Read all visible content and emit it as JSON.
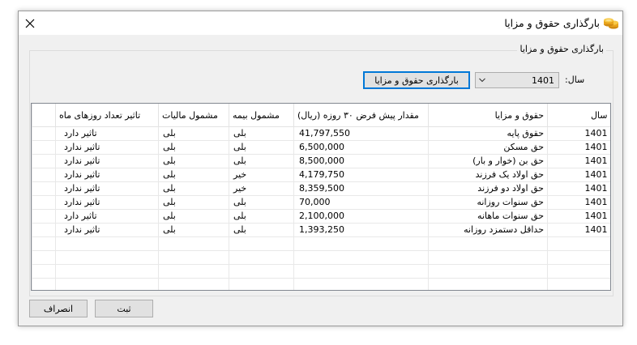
{
  "window": {
    "title": "بارگذاری حقوق و مزایا",
    "icon": "coins-icon"
  },
  "group": {
    "legend": "بارگذاری حقوق و مزایا"
  },
  "filter": {
    "year_label": "سال:",
    "year_value": "1401",
    "load_button": "بارگذاری حقوق و مزایا"
  },
  "table": {
    "columns": [
      "سال",
      "حقوق و مزایا",
      "مقدار پیش فرض ۳۰ روزه (ریال)",
      "مشمول بیمه",
      "مشمول مالیات",
      "تاثیر تعداد روزهای ماه"
    ],
    "rows": [
      [
        "1401",
        "حقوق پایه",
        "41,797,550",
        "بلی",
        "بلی",
        "تاثیر دارد"
      ],
      [
        "1401",
        "حق مسکن",
        "6,500,000",
        "بلی",
        "بلی",
        "تاثیر ندارد"
      ],
      [
        "1401",
        "حق بن (خوار و بار)",
        "8,500,000",
        "بلی",
        "بلی",
        "تاثیر ندارد"
      ],
      [
        "1401",
        "حق اولاد یک فرزند",
        "4,179,750",
        "خیر",
        "بلی",
        "تاثیر ندارد"
      ],
      [
        "1401",
        "حق اولاد دو فرزند",
        "8,359,500",
        "خیر",
        "بلی",
        "تاثیر ندارد"
      ],
      [
        "1401",
        "حق سنوات روزانه",
        "70,000",
        "بلی",
        "بلی",
        "تاثیر ندارد"
      ],
      [
        "1401",
        "حق سنوات ماهانه",
        "2,100,000",
        "بلی",
        "بلی",
        "تاثیر دارد"
      ],
      [
        "1401",
        "حداقل دستمزد روزانه",
        "1,393,250",
        "بلی",
        "بلی",
        "تاثیر ندارد"
      ]
    ]
  },
  "buttons": {
    "save": "ثبت",
    "cancel": "انصراف"
  }
}
